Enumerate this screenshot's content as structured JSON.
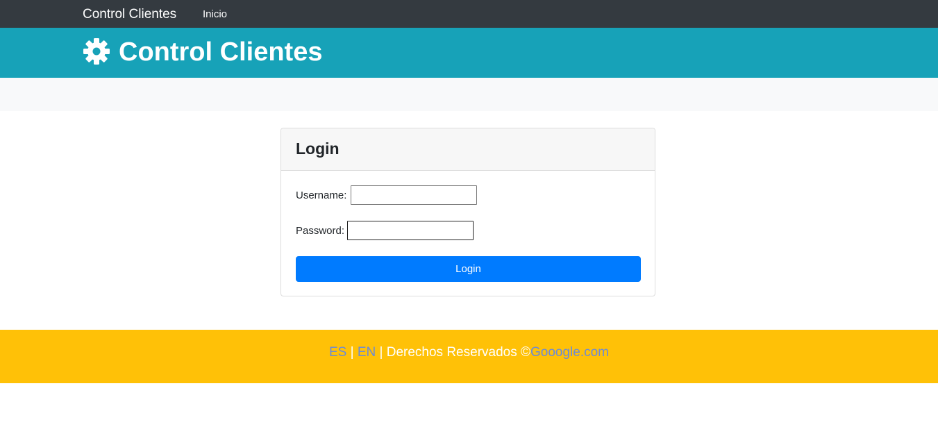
{
  "navbar": {
    "brand": "Control Clientes",
    "links": [
      {
        "label": "Inicio"
      }
    ]
  },
  "header": {
    "icon": "gear-icon",
    "title": "Control Clientes",
    "background_color": "#17a2b8"
  },
  "login_card": {
    "title": "Login",
    "username_label": "Username:",
    "username_value": "",
    "password_label": "Password:",
    "password_value": "",
    "submit_label": "Login",
    "button_color": "#007bff"
  },
  "footer": {
    "lang_es": "ES",
    "separator1": " | ",
    "lang_en": "EN",
    "rights_text": " | Derechos Reservados ©",
    "site_link": "Gooogle.com",
    "background_color": "#ffc107"
  }
}
